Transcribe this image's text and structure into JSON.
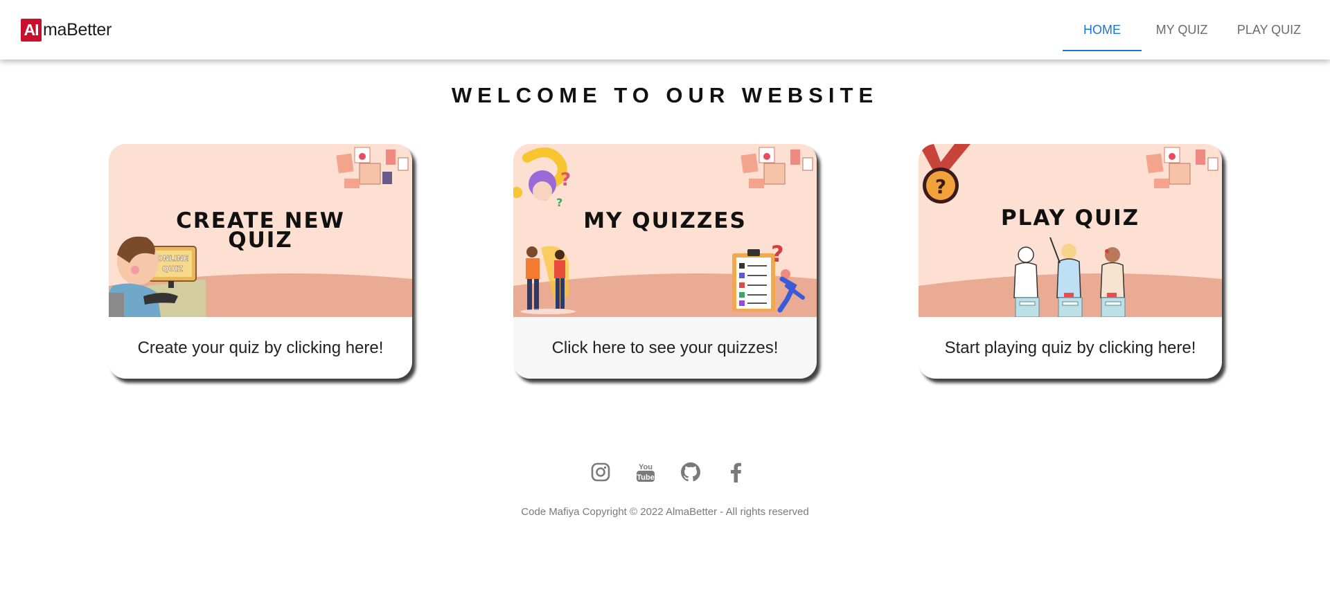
{
  "header": {
    "logo": {
      "badge": "AI",
      "text": "maBetter"
    },
    "nav": [
      {
        "label": "HOME",
        "active": true
      },
      {
        "label": "MY QUIZ",
        "active": false
      },
      {
        "label": "PLAY QUIZ",
        "active": false
      }
    ]
  },
  "main": {
    "title": "WELCOME TO OUR WEBSITE",
    "cards": [
      {
        "image_title_line1": "CREATE NEW",
        "image_title_line2": "QUIZ",
        "image_badge_line1": "ONLINE",
        "image_badge_line2": "QUIZ",
        "text": "Create your quiz by clicking here!"
      },
      {
        "image_title_line1": "MY QUIZZES",
        "text": "Click here to see your quizzes!"
      },
      {
        "image_title_line1": "PLAY QUIZ",
        "text": "Start playing quiz by clicking here!"
      }
    ]
  },
  "footer": {
    "social_icons": [
      "instagram-icon",
      "youtube-icon",
      "github-icon",
      "facebook-icon"
    ],
    "youtube_glyph_top": "You",
    "youtube_glyph_bottom": "Tube",
    "copyright": "Code Mafiya Copyright © 2022 AlmaBetter - All rights reserved"
  },
  "colors": {
    "accent": "#1976d2",
    "brand": "#c8102e",
    "card_bg": "#fde0d2",
    "card_ground": "#e9ab94",
    "icon": "#7a7a7a"
  }
}
